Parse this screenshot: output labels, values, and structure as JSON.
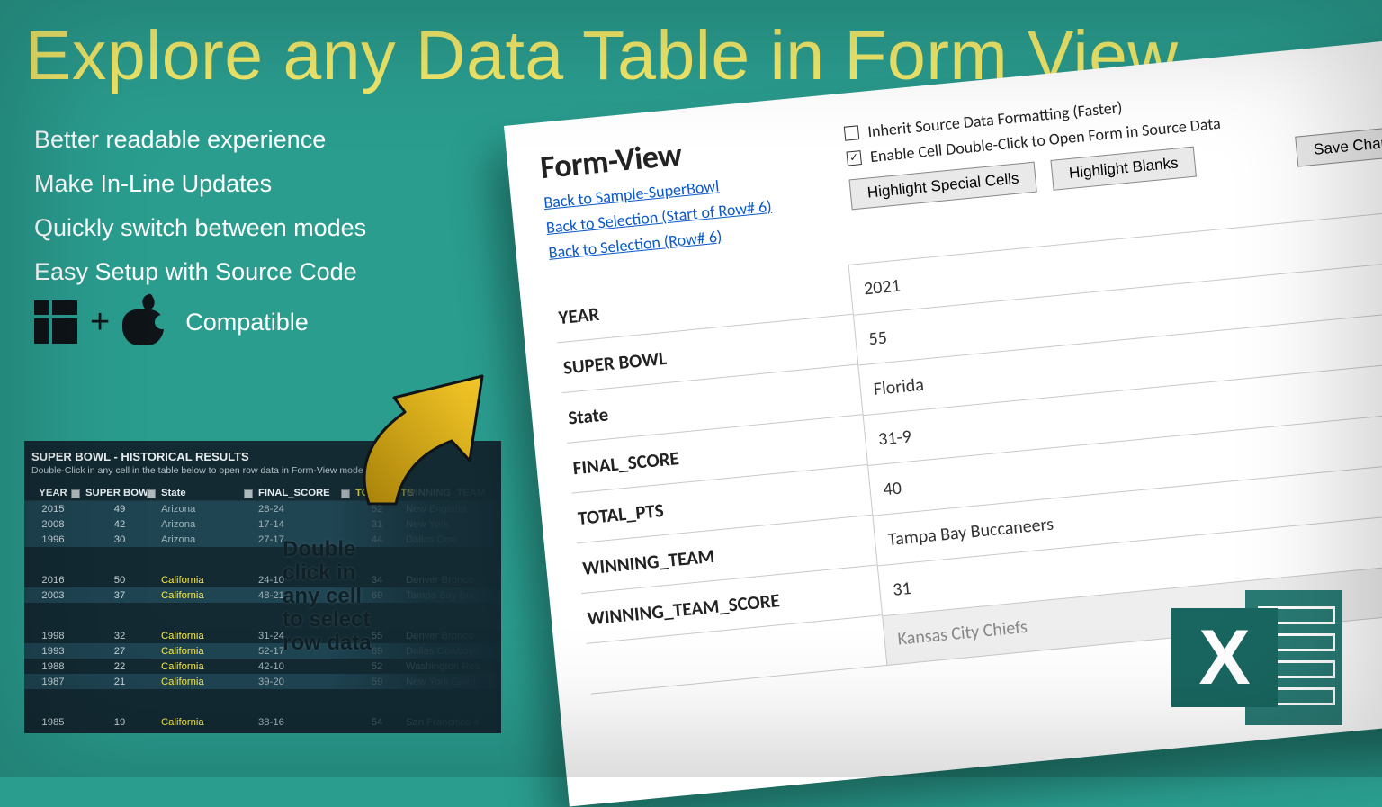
{
  "headline": "Explore any Data Table in Form View",
  "bullets": [
    "Better readable experience",
    "Make In-Line Updates",
    "Quickly switch between modes",
    "Easy Setup with Source Code"
  ],
  "compat_label": "Compatible",
  "overlay_instruction": {
    "l1": "Double",
    "l2": "click in",
    "l3": "any cell",
    "l4": "to select",
    "l5": "row data"
  },
  "small_table": {
    "title": "SUPER BOWL - HISTORICAL RESULTS",
    "sub": "Double-Click in any cell in the table below to open row data in Form-View mode",
    "headers": [
      "YEAR",
      "SUPER BOWL",
      "State",
      "FINAL_SCORE",
      "TOTAL_PTS",
      "WINNING_TEAM"
    ],
    "rows": [
      {
        "year": "2015",
        "sb": "49",
        "state": "Arizona",
        "score": "28-24",
        "pts": "52",
        "team": "New England",
        "hi": false,
        "sel": true
      },
      {
        "year": "2008",
        "sb": "42",
        "state": "Arizona",
        "score": "17-14",
        "pts": "31",
        "team": "New York",
        "hi": false,
        "sel": true
      },
      {
        "year": "1996",
        "sb": "30",
        "state": "Arizona",
        "score": "27-17",
        "pts": "44",
        "team": "Dallas Cow",
        "hi": false,
        "sel": true
      },
      {
        "gap": true
      },
      {
        "year": "2016",
        "sb": "50",
        "state": "California",
        "score": "24-10",
        "pts": "34",
        "team": "Denver Bronco",
        "hi": true,
        "sel": false
      },
      {
        "year": "2003",
        "sb": "37",
        "state": "California",
        "score": "48-21",
        "pts": "69",
        "team": "Tampa Bay Buc",
        "hi": true,
        "sel": true
      },
      {
        "gap": true
      },
      {
        "year": "1998",
        "sb": "32",
        "state": "California",
        "score": "31-24",
        "pts": "55",
        "team": "Denver Bronco",
        "hi": true,
        "sel": false
      },
      {
        "year": "1993",
        "sb": "27",
        "state": "California",
        "score": "52-17",
        "pts": "69",
        "team": "Dallas Cowboys",
        "hi": true,
        "sel": true
      },
      {
        "year": "1988",
        "sb": "22",
        "state": "California",
        "score": "42-10",
        "pts": "52",
        "team": "Washington Res",
        "hi": true,
        "sel": false
      },
      {
        "year": "1987",
        "sb": "21",
        "state": "California",
        "score": "39-20",
        "pts": "59",
        "team": "New York Giant",
        "hi": true,
        "sel": true
      },
      {
        "gap": true
      },
      {
        "year": "1985",
        "sb": "19",
        "state": "California",
        "score": "38-16",
        "pts": "54",
        "team": "San Francisco 4",
        "hi": true,
        "sel": false
      }
    ]
  },
  "form_panel": {
    "title": "Form-View",
    "links": [
      "Back to Sample-SuperBowl",
      "Back to Selection (Start of Row# 6)",
      "Back to Selection (Row# 6)"
    ],
    "checks": [
      {
        "label": "Inherit Source Data Formatting (Faster)",
        "checked": false
      },
      {
        "label": "Enable Cell Double-Click to Open Form in Source Data",
        "checked": true
      }
    ],
    "buttons": [
      "Highlight Special Cells",
      "Highlight Blanks",
      "Save Changes"
    ],
    "fields": [
      {
        "label": "YEAR",
        "value": "2021"
      },
      {
        "label": "SUPER BOWL",
        "value": "55"
      },
      {
        "label": "State",
        "value": "Florida"
      },
      {
        "label": "FINAL_SCORE",
        "value": "31-9"
      },
      {
        "label": "TOTAL_PTS",
        "value": "40"
      },
      {
        "label": "WINNING_TEAM",
        "value": "Tampa Bay Buccaneers"
      },
      {
        "label": "WINNING_TEAM_SCORE",
        "value": "31"
      },
      {
        "label": "",
        "value": "Kansas City Chiefs",
        "muted": true
      }
    ]
  }
}
